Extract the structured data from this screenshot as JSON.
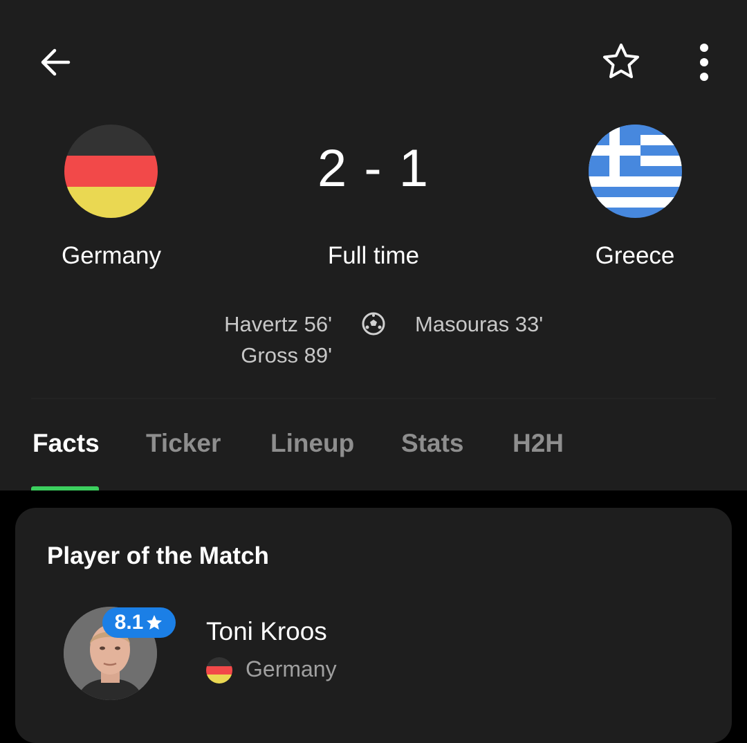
{
  "match": {
    "home_team": {
      "name": "Germany",
      "flag_icon": "germany-flag"
    },
    "away_team": {
      "name": "Greece",
      "flag_icon": "greece-flag"
    },
    "score": "2 - 1",
    "status": "Full time",
    "home_scorers": [
      "Havertz 56'",
      "Gross 89'"
    ],
    "away_scorers": [
      "Masouras 33'"
    ]
  },
  "toolbar": {
    "back_icon": "arrow-left-icon",
    "favorite_icon": "star-outline-icon",
    "more_icon": "more-vertical-icon"
  },
  "tabs": [
    {
      "label": "Facts",
      "active": true
    },
    {
      "label": "Ticker",
      "active": false
    },
    {
      "label": "Lineup",
      "active": false
    },
    {
      "label": "Stats",
      "active": false
    },
    {
      "label": "H2H",
      "active": false
    }
  ],
  "player_of_match": {
    "title": "Player of the Match",
    "player_name": "Toni Kroos",
    "rating": "8.1",
    "country": "Germany"
  },
  "colors": {
    "background": "#1e1e1e",
    "accent_green": "#3ccf5e",
    "rating_blue": "#1b7fe6"
  }
}
